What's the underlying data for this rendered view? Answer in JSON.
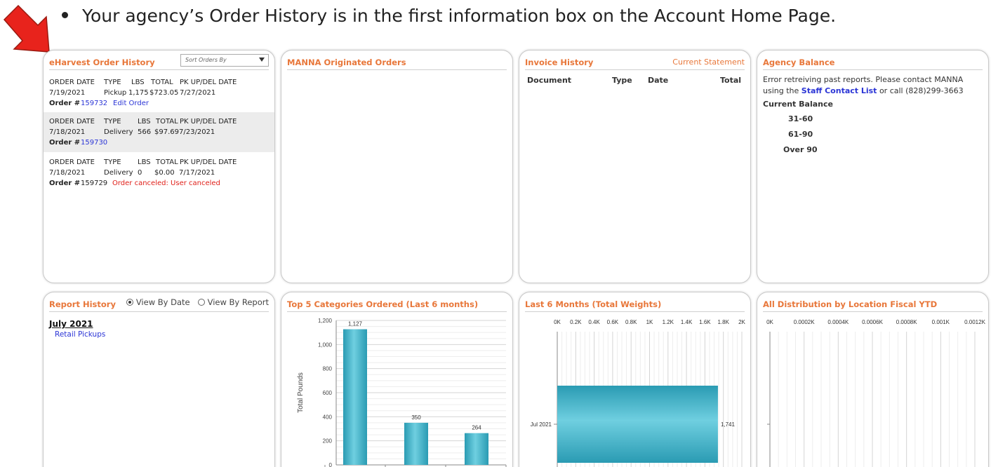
{
  "caption": "Your agency’s Order History is in the first information box on the Account Home Page.",
  "colors": {
    "accent": "#e8773a",
    "link": "#2b35d6",
    "error": "#e0201a",
    "arrow": "#e8231c",
    "bar": "#3fb2c8"
  },
  "order_history": {
    "title": "eHarvest Order History",
    "sort_placeholder": "Sort Orders By",
    "headers": [
      "ORDER DATE",
      "TYPE",
      "LBS",
      "TOTAL",
      "PK UP/DEL DATE"
    ],
    "order_label": "Order #",
    "orders": [
      {
        "date": "7/19/2021",
        "type": "Pickup",
        "lbs": "1,175",
        "total": "$723.05",
        "pk_date": "7/27/2021",
        "number": "159732",
        "action": "Edit Order",
        "status": ""
      },
      {
        "date": "7/18/2021",
        "type": "Delivery",
        "lbs": "566",
        "total": "$97.69",
        "pk_date": "7/23/2021",
        "number": "159730",
        "action": "",
        "status": ""
      },
      {
        "date": "7/18/2021",
        "type": "Delivery",
        "lbs": "0",
        "total": "$0.00",
        "pk_date": "7/17/2021",
        "number": "159729",
        "action": "",
        "status": "Order canceled: User canceled"
      }
    ]
  },
  "manna_orders": {
    "title": "MANNA Originated Orders"
  },
  "invoice_history": {
    "title": "Invoice History",
    "current_statement": "Current Statement",
    "headers": [
      "Document",
      "Type",
      "Date",
      "Total"
    ]
  },
  "agency_balance": {
    "title": "Agency Balance",
    "error_pre": "Error retreiving past reports. Please contact MANNA using the",
    "error_link": "Staff Contact List",
    "error_post": "or call (828)299-3663",
    "current_balance": "Current Balance",
    "buckets": [
      "31-60",
      "61-90",
      "Over 90"
    ]
  },
  "report_history": {
    "title": "Report History",
    "option_date": "View By Date",
    "option_report": "View By Report",
    "month": "July 2021",
    "item": "Retail Pickups"
  },
  "chart_data": [
    {
      "type": "bar",
      "title": "Top 5 Categories Ordered (Last 6 months)",
      "ylabel": "Total Pounds",
      "ylim": [
        0,
        1200
      ],
      "yticks": [
        "0",
        "200",
        "400",
        "600",
        "800",
        "1,000",
        "1,200"
      ],
      "series": [
        {
          "values": [
            1127,
            350,
            264
          ]
        }
      ],
      "labels": [
        "1,127",
        "350",
        "264"
      ]
    },
    {
      "type": "bar",
      "orientation": "horizontal",
      "title": "Last 6 Months (Total Weights)",
      "xticks": [
        "0K",
        "0.2K",
        "0.4K",
        "0.6K",
        "0.8K",
        "1K",
        "1.2K",
        "1.4K",
        "1.6K",
        "1.8K",
        "2K"
      ],
      "xlim": [
        0,
        2000
      ],
      "categories": [
        "Jul 2021"
      ],
      "values": [
        1741
      ],
      "labels": [
        "1,741"
      ]
    },
    {
      "type": "bar",
      "orientation": "horizontal",
      "title": "All Distribution by Location Fiscal YTD",
      "xticks": [
        "0K",
        "0.0002K",
        "0.0004K",
        "0.0006K",
        "0.0008K",
        "0.001K",
        "0.0012K"
      ],
      "xlim": [
        0,
        1.2
      ],
      "categories": [],
      "values": []
    }
  ]
}
